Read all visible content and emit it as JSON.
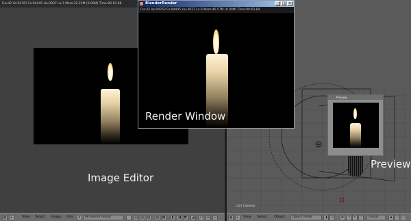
{
  "image_editor": {
    "status": "Fra:42  Ve:94763 Fa:94445 Hu:3037 La:3 Mem:32.23M (0.00M) Time:00:03.88",
    "label": "Image Editor",
    "header": {
      "menus": [
        "View",
        "Select",
        "Image",
        "UVs"
      ],
      "image_name": "IM:Render Result"
    }
  },
  "render_window": {
    "title": "BlenderRender",
    "status": "Fra:42  Ve:94763 Fa:94445 Hu:3037 La:3 Mem:46.57M (0.00M) Time:00:03.84",
    "label": "Render Window"
  },
  "viewport_3d": {
    "preview_title": "Preview",
    "label": "Preview",
    "camera_label": "(42) Camera",
    "header": {
      "menus": [
        "View",
        "Select",
        "Object"
      ],
      "mode": "Object Mode",
      "orientation": "Global"
    }
  },
  "colors": {
    "titlebar_start": "#0a246a",
    "titlebar_end": "#a6caf0",
    "viewport_bg": "#5a5a5a",
    "editor_bg": "#404040"
  }
}
